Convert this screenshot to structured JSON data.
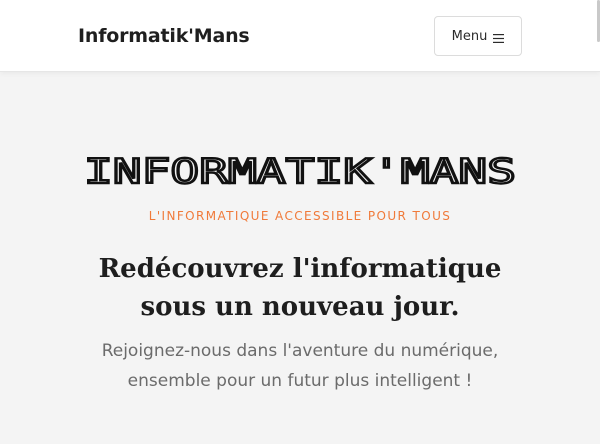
{
  "header": {
    "brand": "Informatik'Mans",
    "menu_label": "Menu",
    "menu_icon": "hamburger-icon"
  },
  "hero": {
    "logo_text": "INFORMATIK'MANS",
    "tagline": "L'INFORMATIQUE ACCESSIBLE POUR TOUS",
    "title_line1": "Redécouvrez l'informatique",
    "title_line2": "sous un nouveau jour.",
    "subtitle_line1": "Rejoignez-nous dans l'aventure du numérique,",
    "subtitle_line2": "ensemble pour un futur plus intelligent !"
  },
  "colors": {
    "accent": "#f07a3a",
    "text_dark": "#1e1e1e",
    "text_muted": "#6b6b6b",
    "background": "#f4f4f4",
    "navbar_bg": "#ffffff"
  }
}
